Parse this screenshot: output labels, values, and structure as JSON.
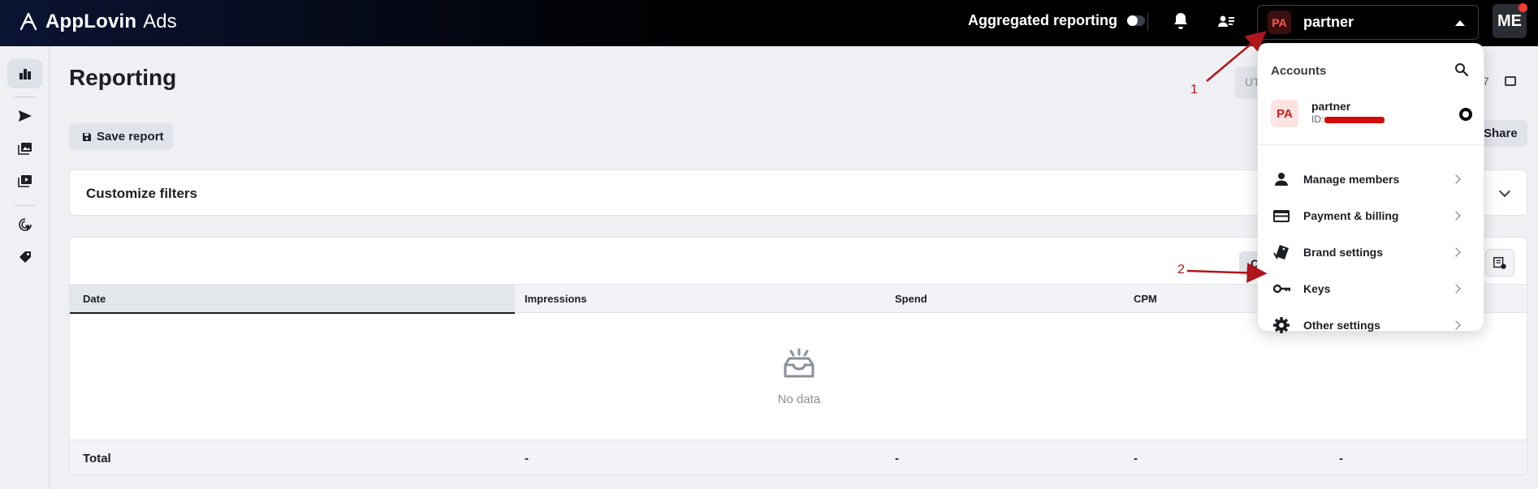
{
  "topbar": {
    "brand": "AppLovin",
    "product": "Ads",
    "aggregated_label": "Aggregated reporting",
    "account_badge": "PA",
    "account_name": "partner",
    "user_initials": "ME"
  },
  "page": {
    "title": "Reporting",
    "save_label": "Save report",
    "timezone_partial": "UT",
    "date_partial": "7",
    "share_label": "Share"
  },
  "filters": {
    "title": "Customize filters"
  },
  "table": {
    "toolbar_partial": "C",
    "columns": [
      "Date",
      "Impressions",
      "Spend",
      "CPM"
    ],
    "empty_text": "No data",
    "total_label": "Total",
    "total_values": [
      "-",
      "-",
      "-",
      "-"
    ]
  },
  "dropdown": {
    "header": "Accounts",
    "account": {
      "badge": "PA",
      "name": "partner",
      "id_prefix": "ID:"
    },
    "items": [
      {
        "label": "Manage members",
        "icon": "person-icon"
      },
      {
        "label": "Payment & billing",
        "icon": "credit-card-icon"
      },
      {
        "label": "Brand settings",
        "icon": "brand-tag-icon"
      },
      {
        "label": "Keys",
        "icon": "key-icon"
      },
      {
        "label": "Other settings",
        "icon": "gear-icon"
      }
    ]
  },
  "annotations": {
    "step1": "1",
    "step2": "2"
  },
  "colors": {
    "topbar": "#000000",
    "annotation": "#b0161b",
    "badge_red": "#ff5a4e"
  }
}
